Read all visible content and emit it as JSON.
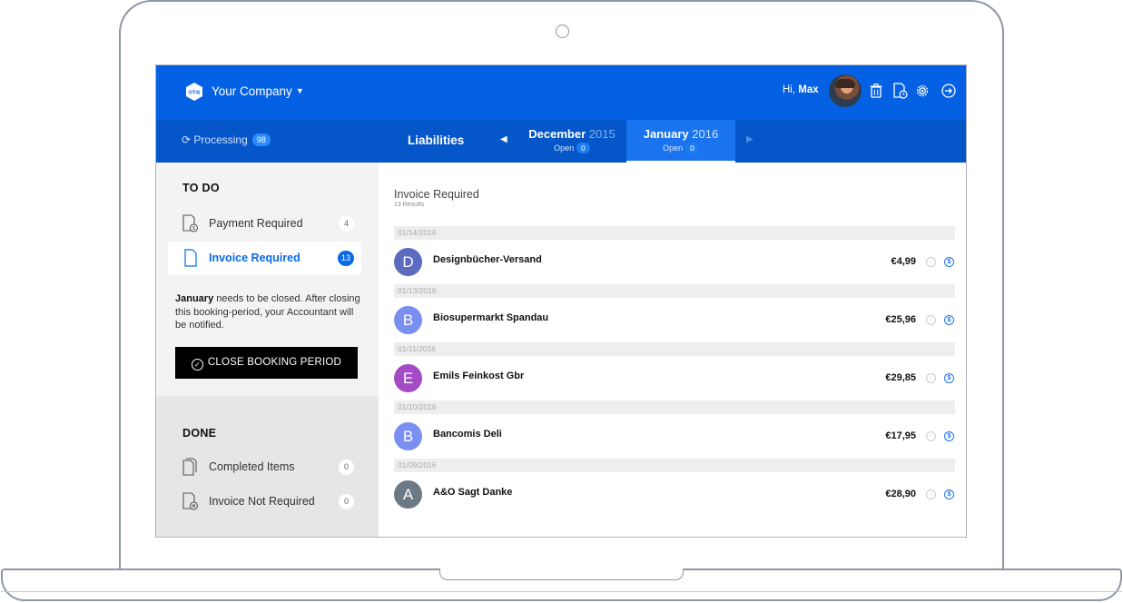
{
  "header": {
    "company": "Your Company",
    "greeting_prefix": "Hi, ",
    "user_name": "Max"
  },
  "subnav": {
    "processing_label": "Processing",
    "processing_count": "98",
    "section_label": "Liabilities",
    "months": [
      {
        "name": "December",
        "year": "2015",
        "status": "Open",
        "count": "0",
        "active": false
      },
      {
        "name": "January",
        "year": "2016",
        "status": "Open",
        "count": "0",
        "active": true
      }
    ]
  },
  "sidebar": {
    "todo_title": "TO DO",
    "todo_items": [
      {
        "label": "Payment Required",
        "count": "4",
        "icon": "payment-document-icon"
      },
      {
        "label": "Invoice Required",
        "count": "13",
        "icon": "document-icon",
        "active": true
      }
    ],
    "notice_month": "January",
    "notice_text": " needs to be closed. After closing this booking-period, your Accountant will be notified.",
    "close_button": "CLOSE BOOKING PERIOD",
    "done_title": "DONE",
    "done_items": [
      {
        "label": "Completed Items",
        "count": "0",
        "icon": "documents-stack-icon"
      },
      {
        "label": "Invoice Not Required",
        "count": "0",
        "icon": "document-rejected-icon"
      }
    ]
  },
  "main": {
    "title": "Invoice Required",
    "subtitle": "13 Results",
    "rows": [
      {
        "date": "01/14/2016",
        "initial": "D",
        "name": "Designbücher-Versand",
        "amount": "€4,99",
        "color": "#5c6bc0"
      },
      {
        "date": "01/13/2016",
        "initial": "B",
        "name": "Biosupermarkt Spandau",
        "amount": "€25,96",
        "color": "#7b8ff0"
      },
      {
        "date": "01/11/2016",
        "initial": "E",
        "name": "Emils Feinkost Gbr",
        "amount": "€29,85",
        "color": "#a24bc4"
      },
      {
        "date": "01/10/2016",
        "initial": "B",
        "name": "Bancomis Deli",
        "amount": "€17,95",
        "color": "#7b8ff0"
      },
      {
        "date": "01/09/2016",
        "initial": "A",
        "name": "A&O Sagt Danke",
        "amount": "€28,90",
        "color": "#6b7a85"
      }
    ]
  },
  "colors": {
    "primary": "#0561e3",
    "secondary_bar": "#0456c9",
    "accent": "#1a74f0"
  }
}
